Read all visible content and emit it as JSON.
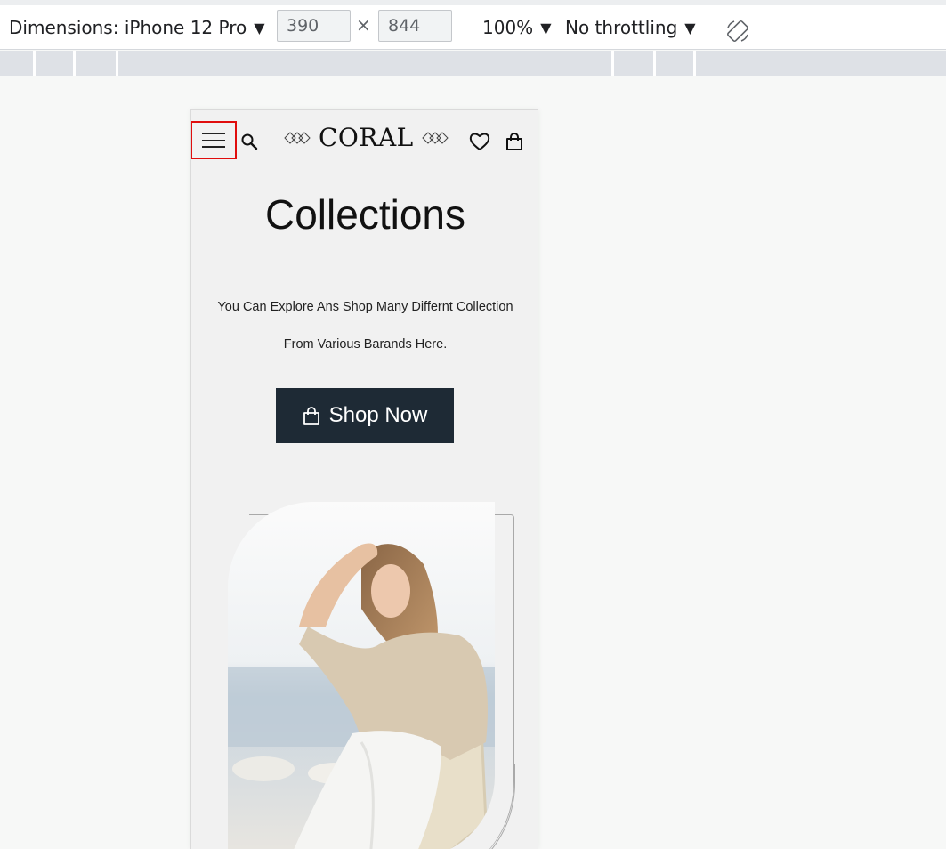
{
  "devtools": {
    "dimensions_label": "Dimensions: iPhone 12 Pro",
    "width_value": "390",
    "height_value": "844",
    "times_symbol": "×",
    "zoom": "100%",
    "throttling": "No throttling",
    "caret": "▼"
  },
  "header": {
    "logo_text": "CORAL"
  },
  "hero": {
    "title": "Collections",
    "subtitle_line1": "You Can Explore Ans Shop Many Differnt Collection",
    "subtitle_line2": "From Various Barands Here.",
    "button_label": "Shop Now"
  },
  "colors": {
    "button_bg": "#1e2a35",
    "highlight": "#e00d0d",
    "page_bg": "#f1f1f1"
  },
  "icons": [
    "menu-icon",
    "search-icon",
    "diamond-icon",
    "heart-icon",
    "bag-icon",
    "rotate-icon"
  ]
}
